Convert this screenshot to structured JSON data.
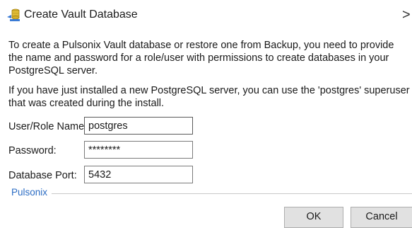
{
  "window": {
    "title": "Create Vault Database",
    "close_glyph": ">"
  },
  "content": {
    "intro_text": "To create a Pulsonix Vault database or restore one from Backup, you need to provide the name and password for a role/user with permissions to create databases in your PostgreSQL server.",
    "hint_text": "If you have just installed a new PostgreSQL server, you can use the 'postgres' superuser that was created during the install."
  },
  "fields": {
    "user": {
      "label": "User/Role Name:",
      "value": "postgres"
    },
    "password": {
      "label": "Password:",
      "value": "********"
    },
    "port": {
      "label": "Database Port:",
      "value": "5432"
    }
  },
  "group": {
    "label": "Pulsonix"
  },
  "buttons": {
    "ok_label": "OK",
    "cancel_label": "Cancel"
  },
  "colors": {
    "group_label": "#2b6cc4",
    "button_face": "#e1e1e1"
  }
}
